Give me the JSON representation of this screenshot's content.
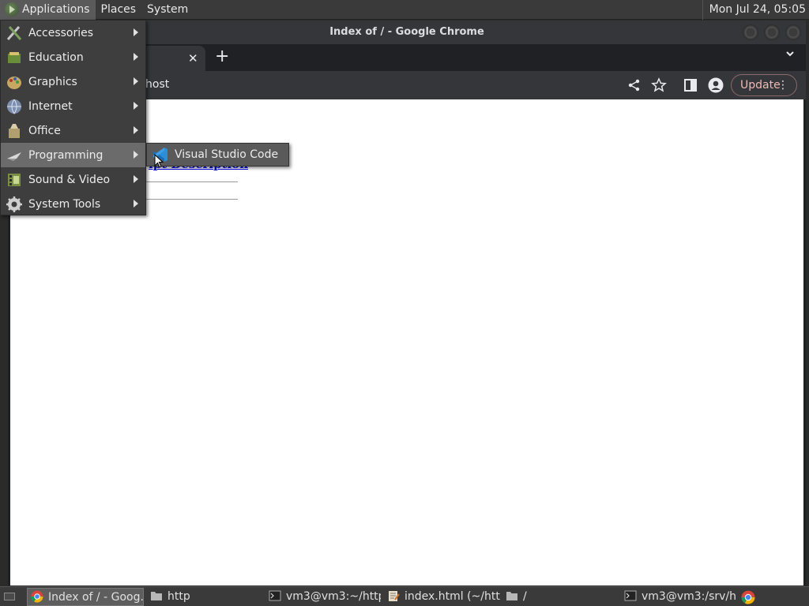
{
  "top_panel": {
    "menus": [
      "Applications",
      "Places",
      "System"
    ],
    "clock": "Mon Jul 24, 05:05"
  },
  "window": {
    "title": "Index of / - Google Chrome",
    "url_partial": "host",
    "update_label": "Update",
    "menu_dots": "⋮",
    "close_tab_glyph": "✕",
    "new_tab_glyph": "+"
  },
  "app_menu": {
    "items": [
      {
        "label": "Accessories",
        "icon": "accessories-icon"
      },
      {
        "label": "Education",
        "icon": "education-icon"
      },
      {
        "label": "Graphics",
        "icon": "graphics-icon"
      },
      {
        "label": "Internet",
        "icon": "internet-globe-icon"
      },
      {
        "label": "Office",
        "icon": "office-icon"
      },
      {
        "label": "Programming",
        "icon": "programming-icon"
      },
      {
        "label": "Sound & Video",
        "icon": "sound-video-icon"
      },
      {
        "label": "System Tools",
        "icon": "system-tools-gear-icon"
      }
    ],
    "highlighted": "Programming",
    "submenu": {
      "label": "Visual Studio Code",
      "icon": "vscode-icon"
    }
  },
  "taskbar": {
    "items": [
      {
        "label": "Index of / - Goog...",
        "icon": "chrome-icon"
      },
      {
        "label": "http",
        "icon": "folder-icon"
      },
      {
        "label": "vm3@vm3:~/http",
        "icon": "terminal-icon"
      },
      {
        "label": "index.html (~/htt...",
        "icon": "text-editor-icon"
      },
      {
        "label": "/",
        "icon": "folder-icon"
      },
      {
        "label": "vm3@vm3:/srv/h...",
        "icon": "terminal-icon"
      }
    ]
  },
  "colors": {
    "panel": "#3a3a3a",
    "menu_bg": "#3e3e3e",
    "menu_highlight": "#6b6b6b",
    "chrome_dark": "#35363a",
    "update_text": "#f2b8b5",
    "link": "#0000ee"
  }
}
